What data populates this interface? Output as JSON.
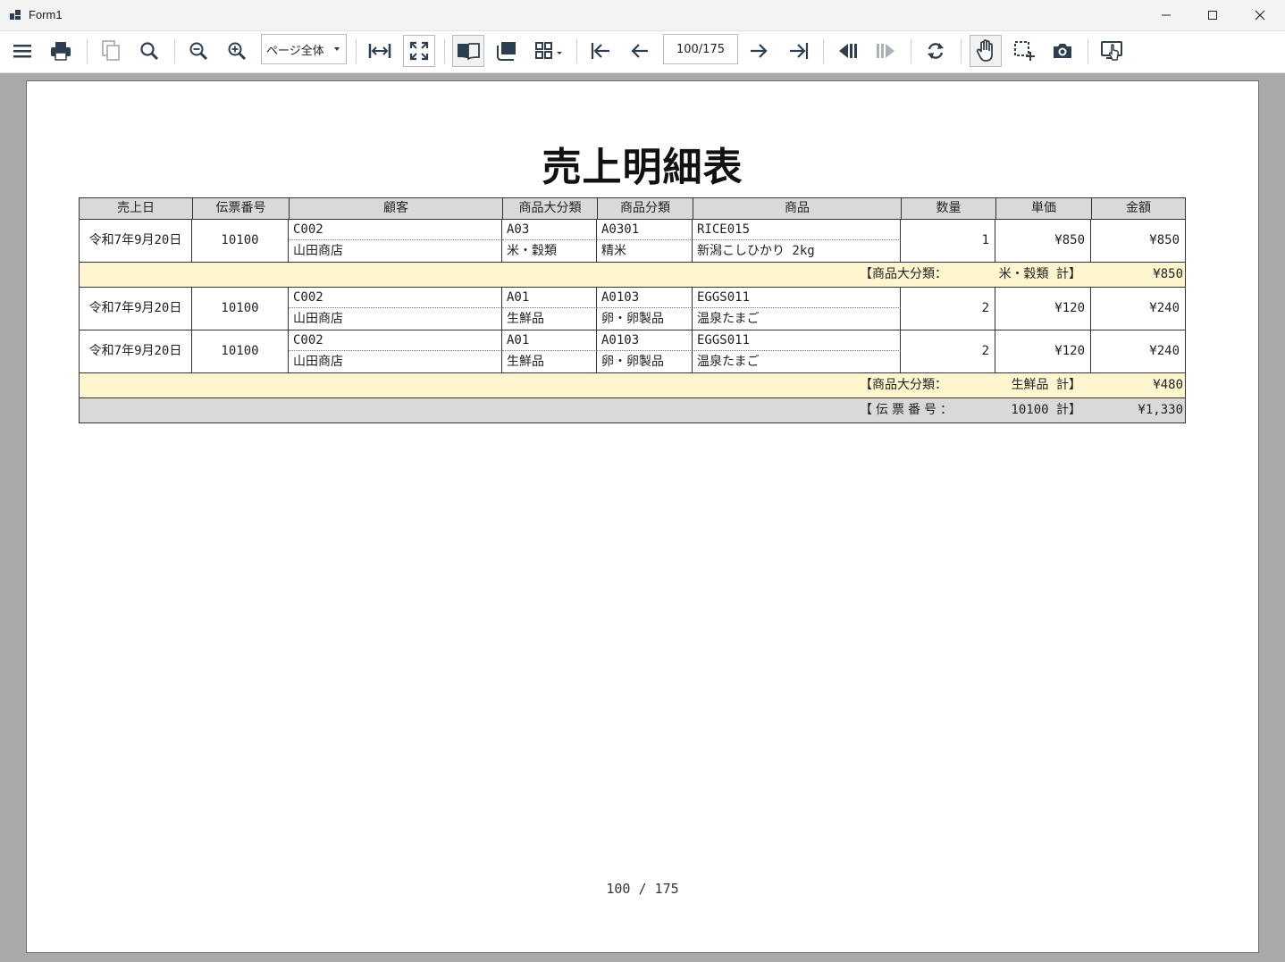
{
  "window": {
    "title": "Form1"
  },
  "toolbar": {
    "zoom_mode": "ページ全体",
    "page_indicator": "100/175",
    "icons": [
      "menu-icon",
      "print-icon",
      "copy-icon",
      "find-icon",
      "zoom-out-icon",
      "zoom-in-icon",
      "fit-width-icon",
      "fit-page-icon",
      "single-page-icon",
      "continuous-icon",
      "multi-page-icon",
      "first-page-icon",
      "prev-page-icon",
      "next-page-icon",
      "last-page-icon",
      "history-back-icon",
      "history-forward-icon",
      "refresh-icon",
      "hand-tool-icon",
      "selection-tool-icon",
      "snapshot-icon",
      "touch-mode-icon"
    ]
  },
  "report": {
    "title": "売上明細表",
    "headers": {
      "date": "売上日",
      "slip": "伝票番号",
      "customer": "顧客",
      "major_category": "商品大分類",
      "category": "商品分類",
      "product": "商品",
      "qty": "数量",
      "unit_price": "単価",
      "amount": "金額"
    },
    "rows": [
      {
        "date": "令和7年9月20日",
        "slip": "10100",
        "customer_code": "C002",
        "customer_name": "山田商店",
        "major_code": "A03",
        "major_name": "米・穀類",
        "cat_code": "A0301",
        "cat_name": "精米",
        "product_code": "RICE015",
        "product_name": "新潟こしひかり 2kg",
        "qty": "1",
        "unit_price": "¥850",
        "amount": "¥850"
      },
      {
        "date": "令和7年9月20日",
        "slip": "10100",
        "customer_code": "C002",
        "customer_name": "山田商店",
        "major_code": "A01",
        "major_name": "生鮮品",
        "cat_code": "A0103",
        "cat_name": "卵・卵製品",
        "product_code": "EGGS011",
        "product_name": "温泉たまご",
        "qty": "2",
        "unit_price": "¥120",
        "amount": "¥240"
      },
      {
        "date": "令和7年9月20日",
        "slip": "10100",
        "customer_code": "C002",
        "customer_name": "山田商店",
        "major_code": "A01",
        "major_name": "生鮮品",
        "cat_code": "A0103",
        "cat_name": "卵・卵製品",
        "product_code": "EGGS011",
        "product_name": "温泉たまご",
        "qty": "2",
        "unit_price": "¥120",
        "amount": "¥240"
      }
    ],
    "subtotals": [
      {
        "label": "【商品大分類：",
        "value_label": "米・穀類 計】",
        "amount": "¥850"
      },
      {
        "label": "【商品大分類：",
        "value_label": "生鮮品 計】",
        "amount": "¥480"
      }
    ],
    "slip_total": {
      "label": "【伝票番号：",
      "value_label": "10100 計】",
      "amount": "¥1,330"
    },
    "page_number": "100 / 175"
  }
}
